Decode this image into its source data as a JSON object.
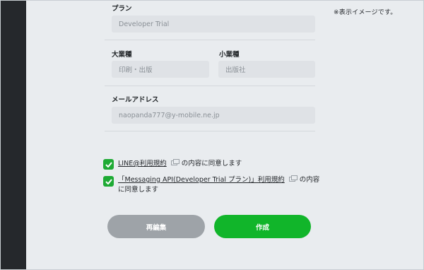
{
  "note": "※表示イメージです。",
  "form": {
    "plan": {
      "label": "プラン",
      "value": "Developer Trial"
    },
    "major_industry": {
      "label": "大業種",
      "value": "印刷・出版"
    },
    "minor_industry": {
      "label": "小業種",
      "value": "出版社"
    },
    "email": {
      "label": "メールアドレス",
      "value": "naopanda777@y-mobile.ne.jp"
    }
  },
  "agreements": [
    {
      "link": "LINE@利用規約",
      "suffix": "の内容に同意します",
      "checked": true
    },
    {
      "link": "「Messaging API(Developer Trial プラン)」利用規約",
      "suffix": "の内容",
      "suffix2": "に同意します",
      "checked": true
    }
  ],
  "buttons": {
    "edit": "再編集",
    "create": "作成"
  },
  "colors": {
    "accent_green": "#11b52a",
    "checkbox_green": "#1eaa34",
    "disabled_gray": "#9ea3a8",
    "sidebar_dark": "#25282c",
    "background": "#e9ecef",
    "field": "#dfe2e6"
  },
  "icons": {
    "external_link": "external-link-icon",
    "check": "check-icon"
  }
}
